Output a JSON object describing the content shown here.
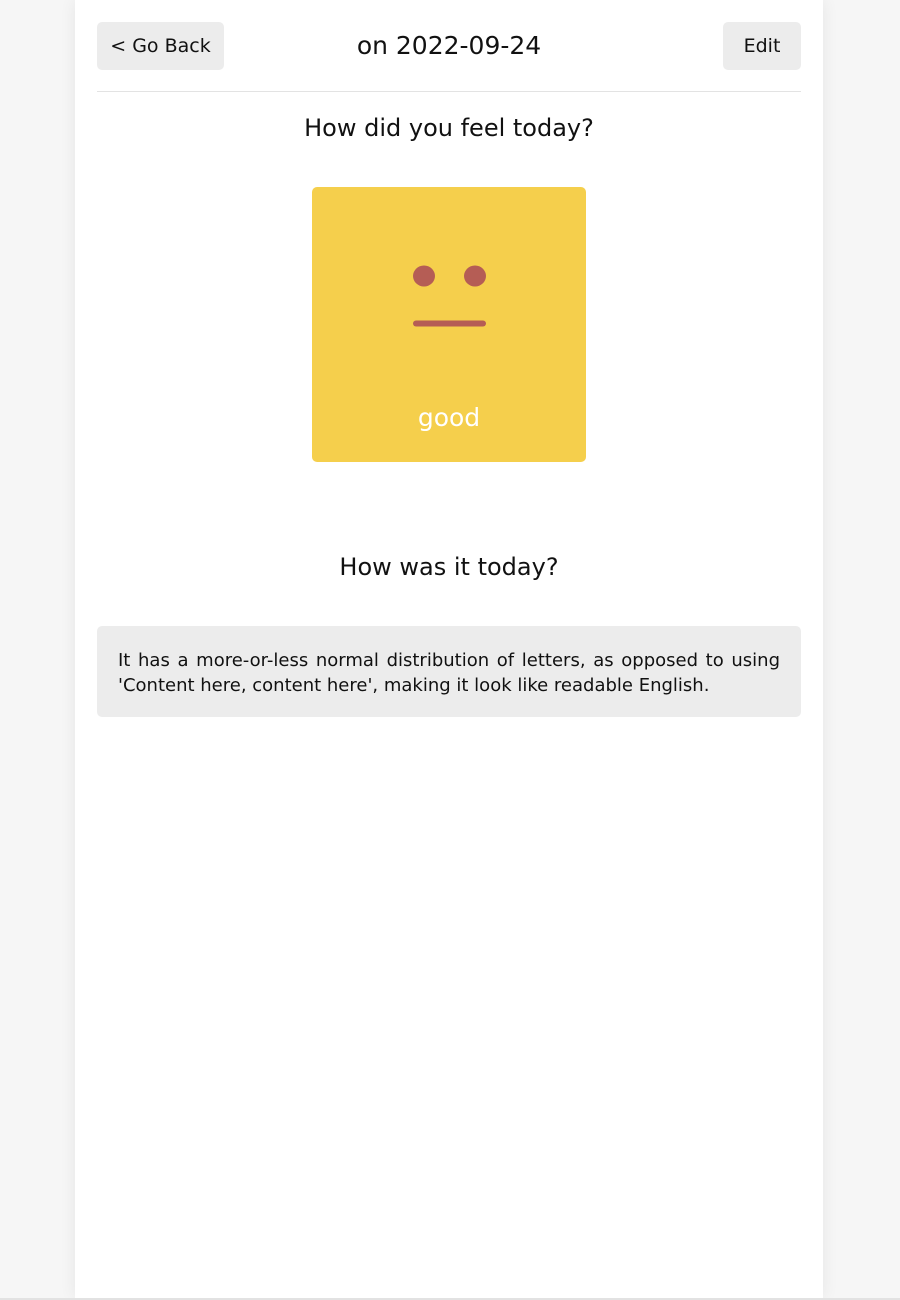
{
  "header": {
    "back_label": "< Go Back",
    "title": "on 2022-09-24",
    "edit_label": "Edit"
  },
  "emotion_section": {
    "question": "How did you feel today?",
    "emotion": {
      "label": "good",
      "icon": "neutral-face-icon",
      "card_color": "#f5cf4c",
      "face_color": "#b55d55"
    }
  },
  "diary_section": {
    "question": "How was it today?",
    "content": "It has a more-or-less normal distribution of letters, as opposed to using 'Content here, content here', making it look like readable English."
  }
}
